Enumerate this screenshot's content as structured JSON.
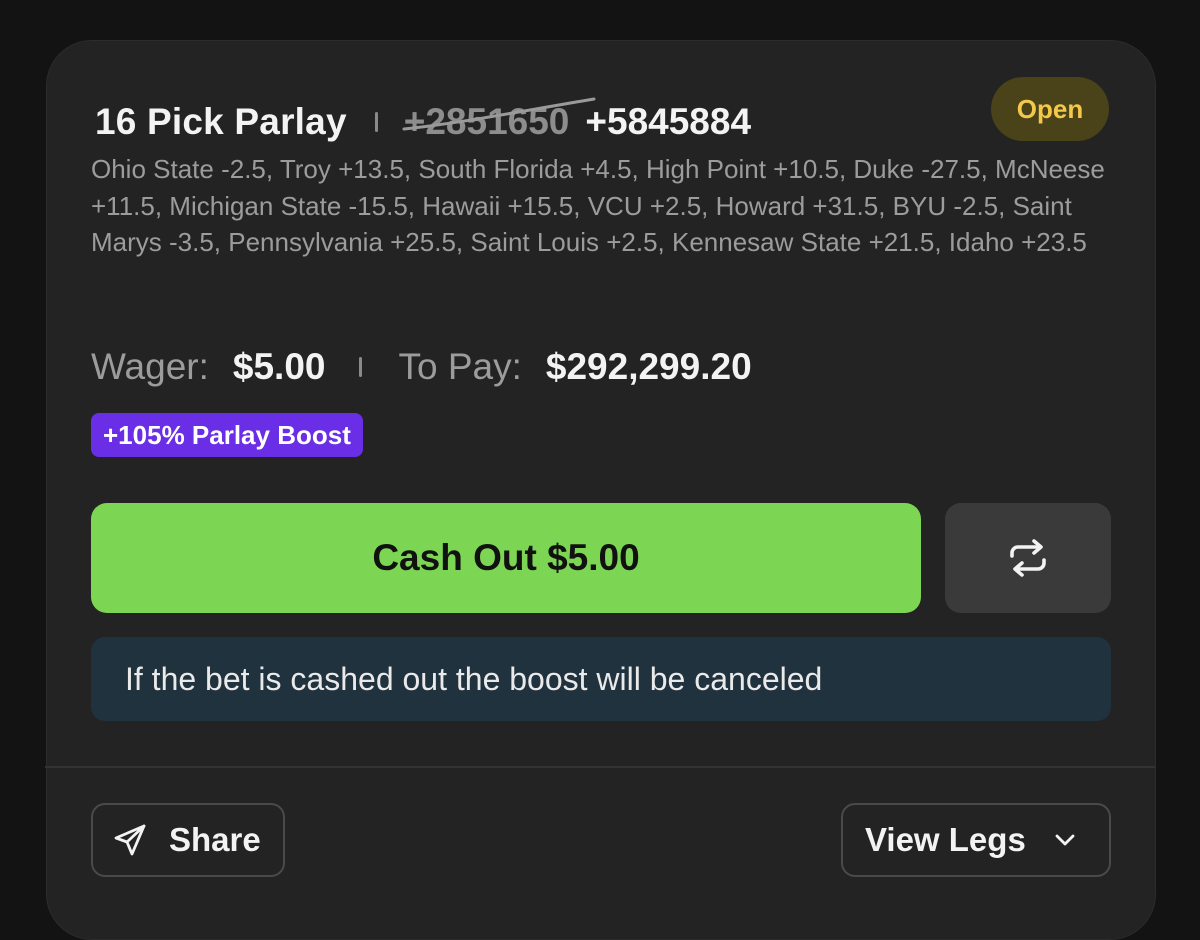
{
  "bet": {
    "title": "16 Pick Parlay",
    "old_odds": "+2851650",
    "new_odds": "+5845884",
    "status": "Open",
    "legs_summary": "Ohio State -2.5, Troy +13.5, South Florida +4.5, High Point +10.5, Duke -27.5, McNeese +11.5, Michigan State -15.5, Hawaii +15.5, VCU +2.5, Howard +31.5, BYU -2.5, Saint Marys -3.5, Pennsylvania +25.5, Saint Louis +2.5, Kennesaw State +21.5, Idaho +23.5",
    "wager_label": "Wager:",
    "wager_value": "$5.00",
    "pay_label": "To Pay:",
    "pay_value": "$292,299.20",
    "boost_label": "+105% Parlay Boost"
  },
  "actions": {
    "cashout_label": "Cash Out $5.00",
    "swap_icon": "swap-arrows-icon",
    "notice": "If the bet is cashed out the boost will be canceled",
    "share_label": "Share",
    "share_icon": "send-icon",
    "view_legs_label": "View Legs",
    "view_legs_icon": "chevron-down-icon"
  },
  "colors": {
    "background": "#131313",
    "card": "#232323",
    "open_badge_bg": "#4a4219",
    "open_badge_text": "#f4c94a",
    "boost_bg": "#6a2ee6",
    "cashout_bg": "#7cd653",
    "notice_bg": "#21323f"
  }
}
